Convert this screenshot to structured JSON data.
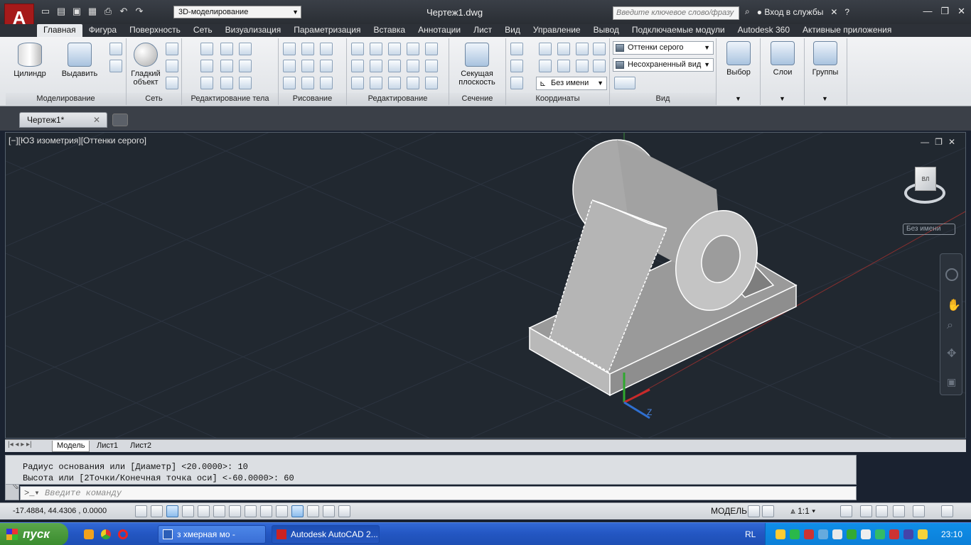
{
  "titlebar": {
    "logo": "A",
    "workspace": "3D-моделирование",
    "doc_title": "Чертеж1.dwg",
    "search_placeholder": "Введите ключевое слово/фразу",
    "signin": "Вход в службы"
  },
  "tabs": [
    "Главная",
    "Фигура",
    "Поверхность",
    "Сеть",
    "Визуализация",
    "Параметризация",
    "Вставка",
    "Аннотации",
    "Лист",
    "Вид",
    "Управление",
    "Вывод",
    "Подключаемые модули",
    "Autodesk 360",
    "Активные приложения"
  ],
  "ribbon": {
    "modeling": {
      "title": "Моделирование",
      "cylinder": "Цилиндр",
      "extrude": "Выдавить"
    },
    "mesh": {
      "title": "Сеть",
      "smooth": "Гладкий объект"
    },
    "solid_edit": {
      "title": "Редактирование тела"
    },
    "draw": {
      "title": "Рисование"
    },
    "modify": {
      "title": "Редактирование"
    },
    "section": {
      "title": "Сечение",
      "plane": "Секущая плоскость"
    },
    "coords": {
      "title": "Координаты",
      "ucs_name": "Без имени"
    },
    "view": {
      "title": "Вид",
      "visual_style": "Оттенки серого",
      "saved_view": "Несохраненный вид"
    },
    "selection": {
      "label": "Выбор"
    },
    "layers": {
      "label": "Слои"
    },
    "groups": {
      "label": "Группы"
    }
  },
  "doctabs": {
    "active": "Чертеж1*"
  },
  "viewport": {
    "label": "[−][ЮЗ изометрия][Оттенки серого]",
    "viewname": "Без имени",
    "cube_face": "ВЛ"
  },
  "layout_tabs": [
    "Модель",
    "Лист1",
    "Лист2"
  ],
  "command": {
    "history": [
      "Радиус основания или [Диаметр] <20.0000>: 10",
      "Высота или [2Точки/Конечная точка оси] <-60.0000>: 60"
    ],
    "placeholder": "Введите команду"
  },
  "status": {
    "coords": "-17.4884, 44.4306 , 0.0000",
    "model": "МОДЕЛЬ",
    "scale": "1:1"
  },
  "taskbar": {
    "start": "пуск",
    "tasks": [
      "з хмерная мо - Micro...",
      "Autodesk AutoCAD 2..."
    ],
    "lang": "RL",
    "clock": "23:10"
  },
  "colors": {
    "accent": "#a51a1a",
    "viewport_bg": "#212830",
    "taskbar": "#2356c2"
  }
}
